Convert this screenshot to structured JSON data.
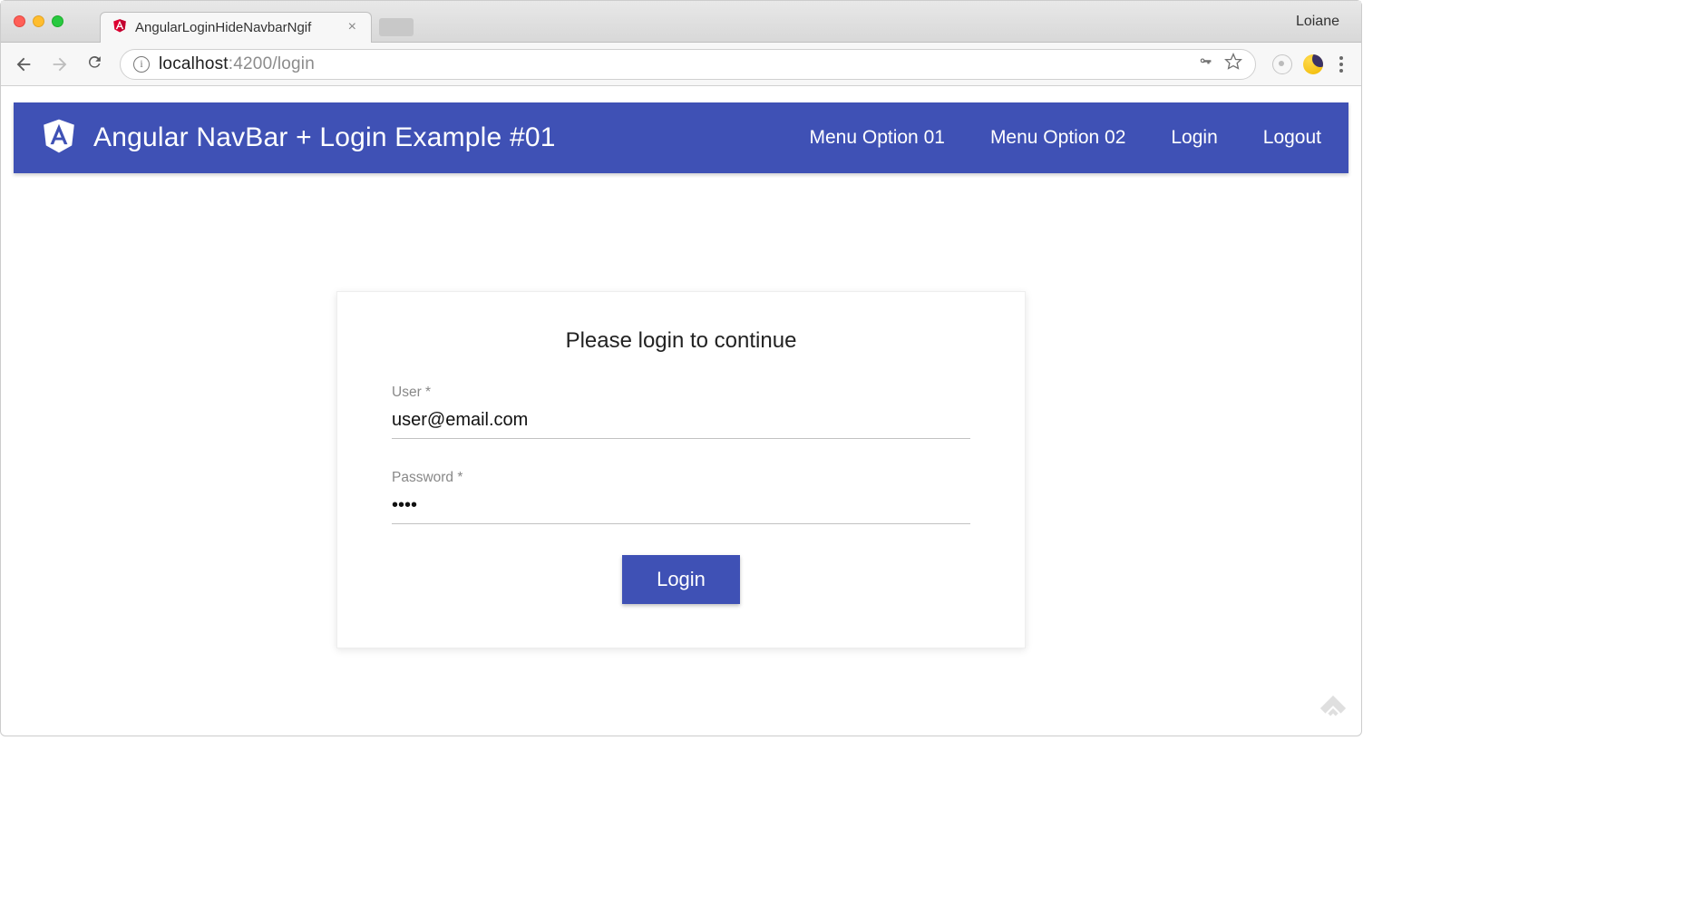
{
  "browser": {
    "tab_title": "AngularLoginHideNavbarNgif",
    "profile": "Loiane",
    "url_prefix": "localhost",
    "url_suffix": ":4200/login"
  },
  "navbar": {
    "title": "Angular NavBar + Login Example #01",
    "links": [
      "Menu Option 01",
      "Menu Option 02",
      "Login",
      "Logout"
    ]
  },
  "login": {
    "heading": "Please login to continue",
    "user_label": "User *",
    "user_value": "user@email.com",
    "password_label": "Password *",
    "password_value": "pass",
    "button": "Login"
  }
}
